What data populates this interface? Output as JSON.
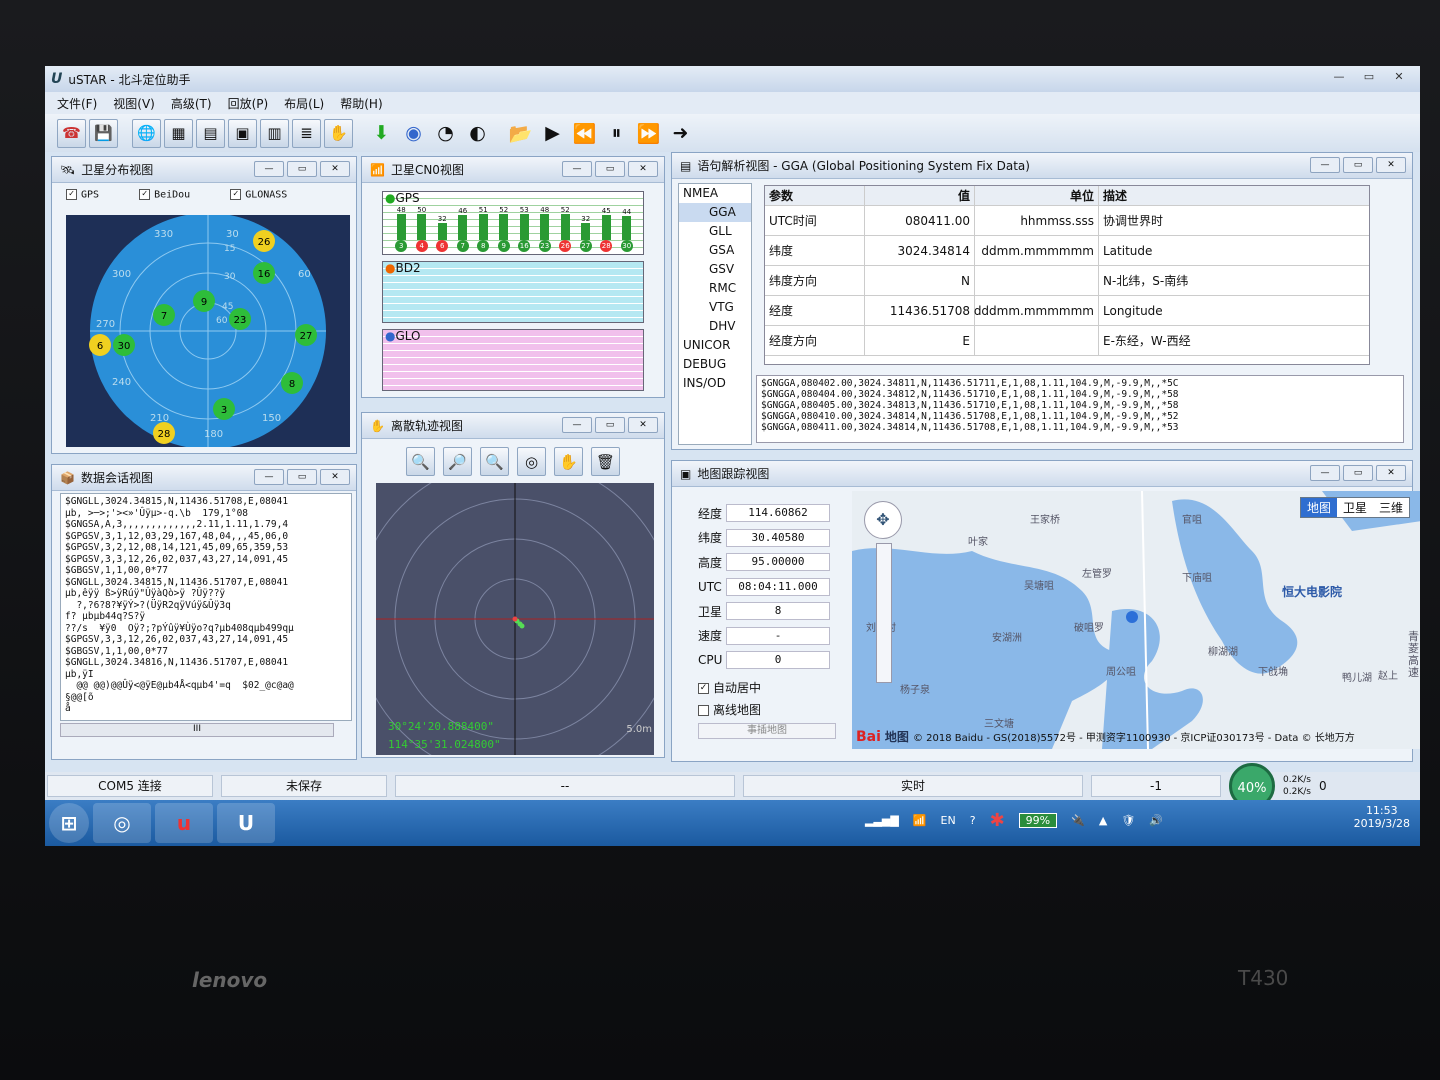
{
  "window": {
    "title": "uSTAR - 北斗定位助手",
    "logo": "U",
    "min": "—",
    "max": "▭",
    "close": "✕"
  },
  "menu": [
    "文件(F)",
    "视图(V)",
    "高级(T)",
    "回放(P)",
    "布局(L)",
    "帮助(H)"
  ],
  "sky": {
    "title": "卫星分布视图",
    "checks": [
      "GPS",
      "BeiDou",
      "GLONASS"
    ],
    "azimuths": [
      "330",
      "30",
      "300",
      "60",
      "270",
      "240",
      "210",
      "150",
      "180"
    ],
    "sats": [
      {
        "id": "26",
        "c": "y"
      },
      {
        "id": "16",
        "c": "g"
      },
      {
        "id": "9",
        "c": "g"
      },
      {
        "id": "7",
        "c": "g"
      },
      {
        "id": "23",
        "c": "g"
      },
      {
        "id": "27",
        "c": "g"
      },
      {
        "id": "6",
        "c": "y"
      },
      {
        "id": "30",
        "c": "g"
      },
      {
        "id": "8",
        "c": "g"
      },
      {
        "id": "3",
        "c": "g"
      },
      {
        "id": "28",
        "c": "y"
      }
    ],
    "ring_labels": [
      "15",
      "30",
      "45",
      "60"
    ]
  },
  "cn0": {
    "title": "卫星CN0视图",
    "gps": "GPS",
    "bd2": "BD2",
    "glo": "GLO",
    "gps_cn0": [
      "48",
      "50",
      "32",
      "46",
      "51",
      "52",
      "53",
      "48",
      "52",
      "32",
      "45",
      "44",
      "37"
    ],
    "gps_sats": [
      "3",
      "4",
      "6",
      "7",
      "8",
      "9",
      "16",
      "23",
      "26",
      "27",
      "28",
      "30"
    ],
    "yaxis": [
      "30",
      "20",
      "10"
    ]
  },
  "log": {
    "title": "数据会话视图",
    "lines": [
      "$GNGLL,3024.34815,N,11436.51708,E,08041",
      "µb, >─>;'><»'Ûÿµ>-q.\\b  179,1°08",
      "$GNGSA,A,3,,,,,,,,,,,,,2.11,1.11,1.79,4",
      "$GPGSV,3,1,12,03,29,167,48,04,,,45,06,0",
      "$GPGSV,3,2,12,08,14,121,45,09,65,359,53",
      "$GPGSV,3,3,12,26,02,037,43,27,14,091,45",
      "$GBGSV,1,1,00,0*77",
      "$GNGLL,3024.34815,N,11436.51707,E,08041",
      "µb,êÿÿ ß>ÿRúÿ\"ÛÿàQò>ÿ ?Ûÿ??ÿ",
      "  ?,?6?8?¥ÿÝ>?(ÜÿR2qÿVúÿ&Ûÿ3q",
      "f? µbµb44q?S?ÿ",
      "??/s  ¥ÿ0  Oÿ?;?pÝûÿ¥Ùÿo?q?µb408qµb499qµ",
      "$GPGSV,3,3,12,26,02,037,43,27,14,091,45",
      "$GBGSV,1,1,00,0*77",
      "$GNGLL,3024.34816,N,11436.51707,E,08041",
      "µb,ÿI",
      "  @@ @@)@@Ûÿ<@ÿE@µb4Å<qµb4'=q  $02_@c@a@",
      "§@@[õ",
      "å"
    ],
    "scroll": "III"
  },
  "scatter": {
    "title": "离散轨迹视图",
    "coord1": "30°24'20.888400\"",
    "coord2": "114°35'31.024800\"",
    "scale": "5.0m"
  },
  "parse": {
    "title": "语句解析视图 - GGA (Global Positioning System Fix Data)",
    "tree": [
      "NMEA",
      "GGA",
      "GLL",
      "GSA",
      "GSV",
      "RMC",
      "VTG",
      "DHV",
      "UNICOR",
      "DEBUG",
      "INS/OD"
    ],
    "headers": [
      "参数",
      "值",
      "单位",
      "描述"
    ],
    "rows": [
      [
        "UTC时间",
        "080411.00",
        "hhmmss.sss",
        "协调世界时"
      ],
      [
        "纬度",
        "3024.34814",
        "ddmm.mmmmmm",
        "Latitude"
      ],
      [
        "纬度方向",
        "N",
        "",
        "N-北纬，S-南纬"
      ],
      [
        "经度",
        "11436.51708",
        "dddmm.mmmmmm",
        "Longitude"
      ],
      [
        "经度方向",
        "E",
        "",
        "E-东经，W-西经"
      ]
    ],
    "raw": [
      "$GNGGA,080402.00,3024.34811,N,11436.51711,E,1,08,1.11,104.9,M,-9.9,M,,*5C",
      "$GNGGA,080404.00,3024.34812,N,11436.51710,E,1,08,1.11,104.9,M,-9.9,M,,*58",
      "$GNGGA,080405.00,3024.34813,N,11436.51710,E,1,08,1.11,104.9,M,-9.9,M,,*58",
      "$GNGGA,080410.00,3024.34814,N,11436.51708,E,1,08,1.11,104.9,M,-9.9,M,,*52",
      "$GNGGA,080411.00,3024.34814,N,11436.51708,E,1,08,1.11,104.9,M,-9.9,M,,*53"
    ]
  },
  "maptrack": {
    "title": "地图跟踪视图",
    "fields": [
      {
        "k": "经度",
        "v": "114.60862"
      },
      {
        "k": "纬度",
        "v": "30.40580"
      },
      {
        "k": "高度",
        "v": "95.00000"
      },
      {
        "k": "UTC",
        "v": "08:04:11.000"
      },
      {
        "k": "卫星",
        "v": "8"
      },
      {
        "k": "速度",
        "v": "-"
      },
      {
        "k": "CPU",
        "v": "0"
      }
    ],
    "auto_center": "自动居中",
    "offline": "离线地图",
    "offline_btn": "事插地图",
    "map_types": [
      "地图",
      "卫星",
      "三维"
    ],
    "places": [
      "王家桥",
      "叶家",
      "吴塘咀",
      "左管罗",
      "下庙咀",
      "官咀",
      "恒大电影院",
      "安湖洲",
      "破咀罗",
      "刘德村",
      "杨子泉",
      "周公咀",
      "柳湖湖",
      "下戗埆",
      "鸭儿湖",
      "三文塘",
      "赵上"
    ],
    "road": "青菱高速",
    "baidu": "Bai",
    "baidu2": "地图",
    "copyright": "© 2018 Baidu - GS(2018)5572号 - 甲测资字1100930 - 京ICP证030173号 - Data © 长地万方"
  },
  "status": {
    "port": "COM5 连接",
    "save": "未保存",
    "dash": "--",
    "realtime": "实时",
    "num": "-1",
    "zero": "0",
    "pct": "40%",
    "up": "0.2K/s",
    "down": "0.2K/s"
  },
  "tray": {
    "lang": "EN",
    "battery": "99%",
    "time": "11:53",
    "date": "2019/3/28"
  },
  "laptop": {
    "brand": "lenovo",
    "model": "T430"
  }
}
